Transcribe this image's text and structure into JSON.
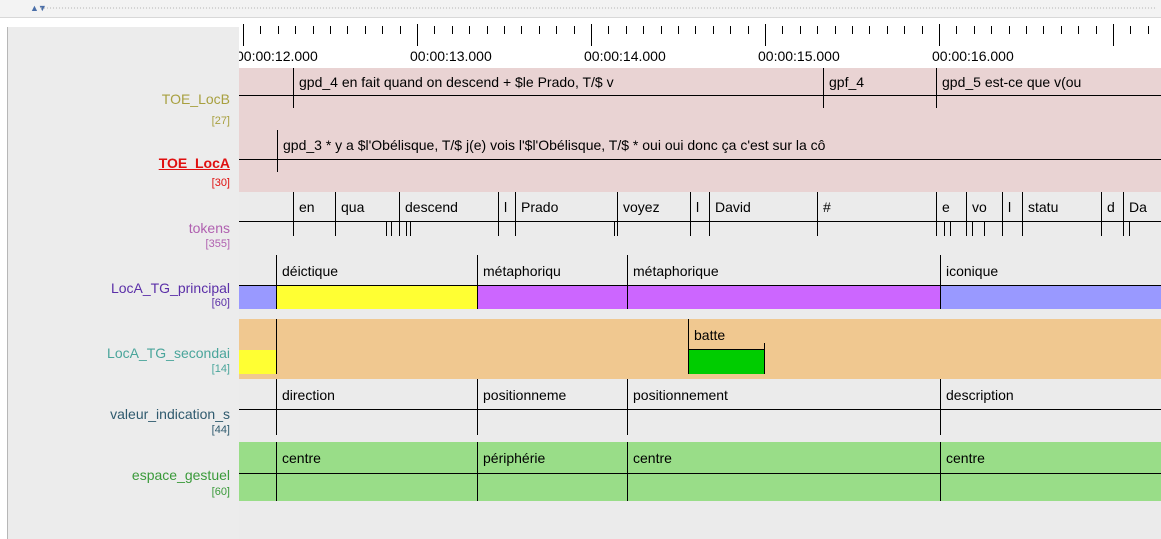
{
  "window": {
    "collapse_icon": "▲▼"
  },
  "ruler": {
    "time_labels": [
      "00:00:12.000",
      "00:00:13.000",
      "00:00:14.000",
      "00:00:15.000",
      "00:00:16.000"
    ],
    "crosshair_icon": "⇕"
  },
  "tiers": [
    {
      "name": "TOE_LocB",
      "count": "[27]",
      "color": "#a8a040"
    },
    {
      "name": "TOE_LocA",
      "count": "[30]",
      "color": "#e01010",
      "active": true
    },
    {
      "name": "tokens",
      "count": "[355]",
      "color": "#b060b0"
    },
    {
      "name": "LocA_TG_principal",
      "count": "[60]",
      "color": "#5b2fa8"
    },
    {
      "name": "LocA_TG_secondai",
      "count": "[14]",
      "color": "#4aa59b"
    },
    {
      "name": "valeur_indication_s",
      "count": "[44]",
      "color": "#2f5a6e"
    },
    {
      "name": "espace_gestuel",
      "count": "[60]",
      "color": "#3a9a3a"
    }
  ],
  "annotations": {
    "TOE_LocB": [
      "gpd_4 en fait quand on descend + $le Prado, T/$ v",
      "gpf_4",
      "gpd_5 est-ce que v(ou"
    ],
    "TOE_LocA": [
      "gpd_3 * y a $l'Obélisque, T/$ j(e) vois l'$l'Obélisque, T/$ * oui oui donc ça c'est sur la cô"
    ],
    "tokens": [
      "en",
      "qua",
      "descend",
      "l",
      "Prado",
      "voyez",
      "l",
      "David",
      "#",
      "e",
      "vo",
      "l",
      "statu",
      "d",
      "Da"
    ],
    "LocA_TG_principal": [
      "déictique",
      "métaphoriqu",
      "métaphorique",
      "iconique"
    ],
    "LocA_TG_secondai": [
      "batte"
    ],
    "valeur_indication_s": [
      "direction",
      "positionneme",
      "positionnement",
      "description"
    ],
    "espace_gestuel": [
      "centre",
      "périphérie",
      "centre",
      "centre"
    ]
  },
  "colors": {
    "toe_bg": "#e9d3d3",
    "tokens_bg": "#ebebeb",
    "deictique": "#ffff33",
    "metaphorique": "#cc66ff",
    "iconique": "#9999ff",
    "secondai_bg": "#f0c890",
    "batte": "#00cc00",
    "espace": "#99dd88"
  }
}
